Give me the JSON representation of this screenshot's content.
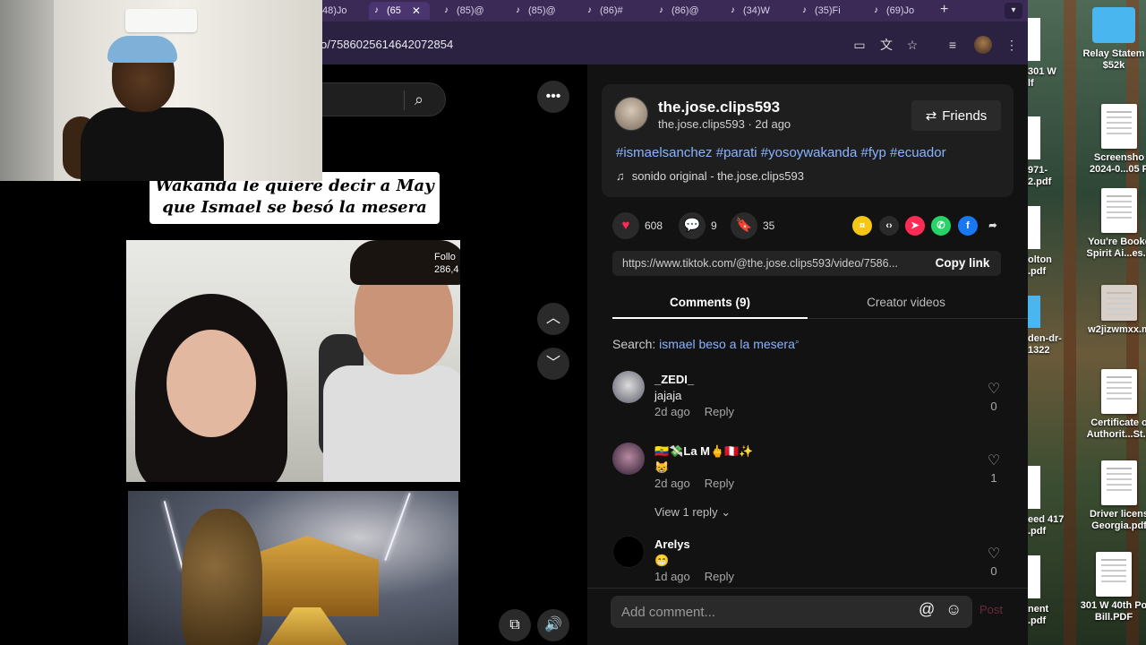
{
  "browser": {
    "tabs": [
      {
        "label": "48)Jo",
        "active": false
      },
      {
        "label": "(65",
        "active": true
      },
      {
        "label": "(85)@",
        "active": false
      },
      {
        "label": "(85)@",
        "active": false
      },
      {
        "label": "(86)#",
        "active": false
      },
      {
        "label": "(86)@",
        "active": false
      },
      {
        "label": "(34)W",
        "active": false
      },
      {
        "label": "(35)Fi",
        "active": false
      },
      {
        "label": "(69)Jo",
        "active": false
      }
    ],
    "url": "o/7586025614642072854"
  },
  "search": {
    "icon": "search-icon"
  },
  "video": {
    "caption_line1": "Wakanda le quiere decir a May",
    "caption_line2": "que Ismael se besó la mesera",
    "overlay_line1": "Follo",
    "overlay_line2": "286,4"
  },
  "post": {
    "author_name": "the.jose.clips593",
    "author_sub": "the.jose.clips593 · 2d ago",
    "friends_label": "Friends",
    "hashtags": "#ismaelsanchez #parati #yosoywakanda #fyp #ecuador",
    "music": "sonido original - the.jose.clips593",
    "likes": "608",
    "comments": "9",
    "saves": "35",
    "link": "https://www.tiktok.com/@the.jose.clips593/video/7586...",
    "copy_label": "Copy link",
    "share_colors": {
      "coin": "#f5c518",
      "repost": "#fe2c55",
      "whatsapp": "#25d366",
      "facebook": "#1877f2"
    }
  },
  "tabs": {
    "comments": "Comments (9)",
    "creator": "Creator videos"
  },
  "search_hint": {
    "prefix": "Search:",
    "query": "ismael beso a la mesera"
  },
  "comments": [
    {
      "name": "_ZEDI_",
      "text": "jajaja",
      "time": "2d ago",
      "reply": "Reply",
      "likes": "0"
    },
    {
      "name": "🇪🇨💸La M🖕🇵🇪✨",
      "text": "😸",
      "time": "2d ago",
      "reply": "Reply",
      "likes": "1",
      "view_replies": "View 1 reply"
    },
    {
      "name": "Arelys",
      "text": "😁",
      "time": "1d ago",
      "reply": "Reply",
      "likes": "0"
    }
  ],
  "comment_bar": {
    "placeholder": "Add comment...",
    "post": "Post"
  },
  "desktop": {
    "right_items": [
      {
        "label": "Relay Statem\n$52k"
      },
      {
        "label": "Screensho\n2024-0...05 P"
      },
      {
        "label": "You're Booke\nSpirit Ai...es.p"
      },
      {
        "label": "w2jizwmxx.m"
      },
      {
        "label": "Certificate o\nAuthorit...St.p"
      },
      {
        "label": "Driver licens\nGeorgia.pdf"
      },
      {
        "label": "301 W 40th Po\nBill.PDF"
      }
    ],
    "left_items": [
      "301 W\nlf",
      "971-\n2.pdf",
      "olton\n.pdf",
      "den-dr-\n1322",
      "eed 417\n.pdf",
      "nent\n.pdf"
    ]
  }
}
